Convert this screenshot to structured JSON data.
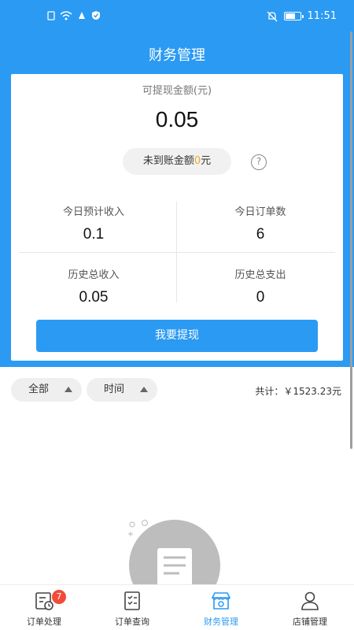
{
  "status": {
    "time": "11:51"
  },
  "header": {
    "title": "财务管理"
  },
  "card": {
    "label": "可提现金额(元)",
    "amount": "0.05",
    "pending_prefix": "未到账金额",
    "pending_value": "0",
    "pending_suffix": "元",
    "help": "?",
    "stats": [
      {
        "label": "今日预计收入",
        "value": "0.1"
      },
      {
        "label": "今日订单数",
        "value": "6"
      },
      {
        "label": "历史总收入",
        "value": "0.05"
      },
      {
        "label": "历史总支出",
        "value": "0"
      }
    ],
    "withdraw_label": "我要提现"
  },
  "filters": {
    "all_label": "全部",
    "time_label": "时间",
    "total_label": "共计：￥1523.23元"
  },
  "tabs": [
    {
      "label": "订单处理",
      "icon": "order-process-icon",
      "badge": "7"
    },
    {
      "label": "订单查询",
      "icon": "order-query-icon"
    },
    {
      "label": "财务管理",
      "icon": "finance-icon"
    },
    {
      "label": "店铺管理",
      "icon": "user-icon"
    }
  ],
  "colors": {
    "primary": "#2b9af3",
    "accent": "#f5a623",
    "badge": "#f24b3a"
  }
}
